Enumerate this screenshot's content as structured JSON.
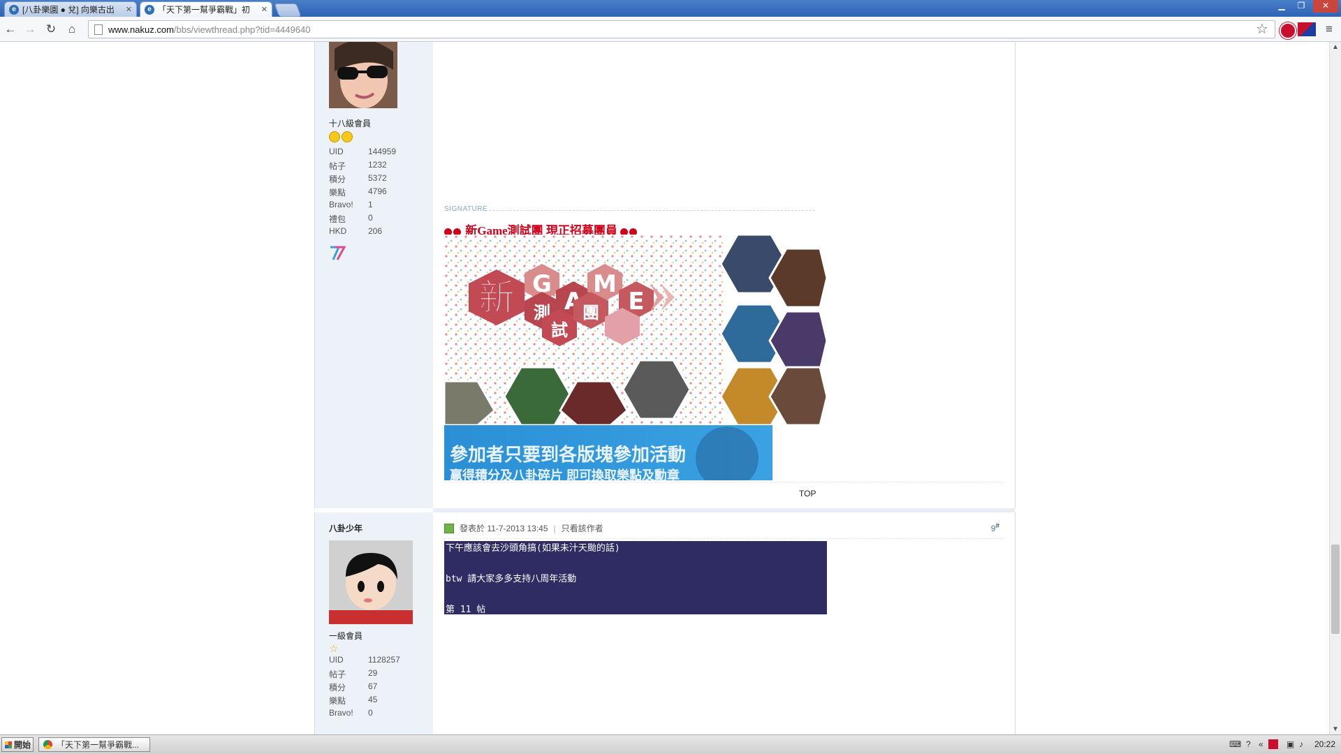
{
  "browser": {
    "tabs": [
      {
        "title": "[八卦樂園 ● 兌] 向樂古出",
        "active": false
      },
      {
        "title": "「天下第一幫爭霸戰」初",
        "active": true
      }
    ],
    "url_host": "www.nakuz.com",
    "url_path": "/bbs/viewthread.php?tid=4449640",
    "icons": [
      "back-icon",
      "forward-icon",
      "reload-icon",
      "home-icon",
      "star-icon",
      "menu-icon"
    ]
  },
  "post1": {
    "rank": "十八級會員",
    "stats": [
      {
        "k": "UID",
        "v": "144959"
      },
      {
        "k": "帖子",
        "v": "1232"
      },
      {
        "k": "積分",
        "v": "5372"
      },
      {
        "k": "樂點",
        "v": "4796"
      },
      {
        "k": "Bravo!",
        "v": "1"
      },
      {
        "k": "禮包",
        "v": "0"
      },
      {
        "k": "HKD",
        "v": "206"
      }
    ],
    "signature_label": "SIGNATURE",
    "signature_title": "新Game測試團 現正招募團員",
    "banner_text": [
      "新",
      "G",
      "A",
      "M",
      "E",
      "測",
      "試",
      "團"
    ],
    "banner2_line1": "參加者只要到各版塊參加活動",
    "banner2_line2": "赢得積分及八卦碎片 即可換取樂點及勳章",
    "top_link": "TOP"
  },
  "post2": {
    "username": "八卦少年",
    "meta_posted": "發表於 11-7-2013 13:45",
    "meta_separator": "|",
    "meta_author_only": "只看該作者",
    "floor": "9",
    "floor_hash": "#",
    "body_lines": [
      "下午應該會去沙頭角搞(如果未汁天颱的話)",
      "",
      "btw 請大家多多支持八周年活動",
      "",
      "第 11 帖"
    ],
    "rank": "一級會員",
    "stats": [
      {
        "k": "UID",
        "v": "1128257"
      },
      {
        "k": "帖子",
        "v": "29"
      },
      {
        "k": "積分",
        "v": "67"
      },
      {
        "k": "樂點",
        "v": "45"
      },
      {
        "k": "Bravo!",
        "v": "0"
      }
    ]
  },
  "taskbar": {
    "start_label": "開始",
    "task_title": "「天下第一幫爭霸戰...",
    "tray_chevron": "«",
    "clock": "20:22"
  }
}
